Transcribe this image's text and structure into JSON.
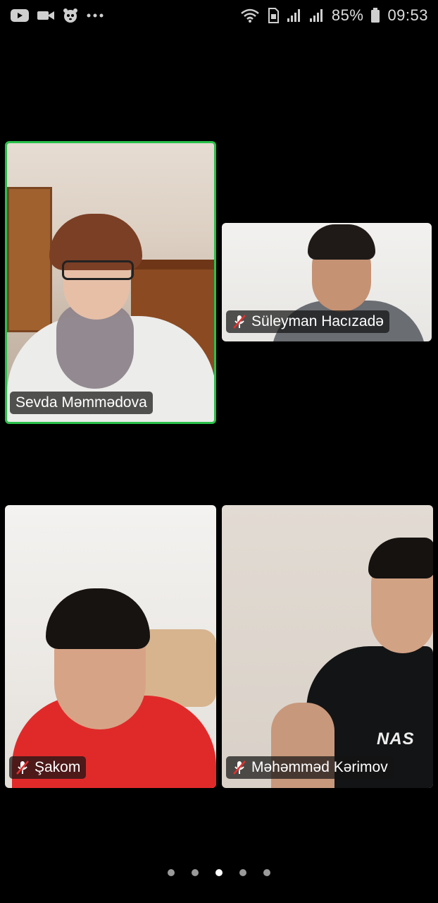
{
  "status_bar": {
    "left_icons": [
      "youtube-icon",
      "video-camera-icon",
      "panda-icon",
      "more-dots-icon"
    ],
    "right_icons": [
      "wifi-icon",
      "sim-icon",
      "signal-icon",
      "signal-icon",
      "battery-icon"
    ],
    "battery": "85%",
    "time": "09:53"
  },
  "participants": [
    {
      "name": "Sevda Məmmədova",
      "muted": false,
      "active_speaker": true
    },
    {
      "name": "Süleyman Hacızadə",
      "muted": true,
      "active_speaker": false
    },
    {
      "name": "Şakom",
      "muted": true,
      "active_speaker": false
    },
    {
      "name": "Məhəmməd Kərimov",
      "muted": true,
      "active_speaker": false
    }
  ],
  "pager": {
    "total": 5,
    "current": 3
  },
  "colors": {
    "active_border": "#29c04a",
    "background": "#000000"
  }
}
